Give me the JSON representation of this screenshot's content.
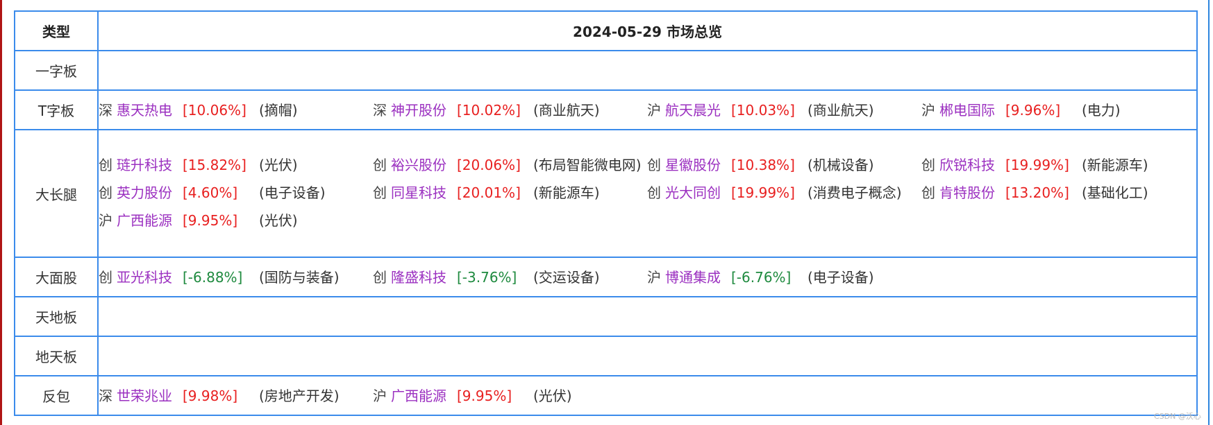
{
  "header": {
    "type_col": "类型",
    "title": "2024-05-29 市场总览"
  },
  "rows": [
    {
      "label": "一字板",
      "items": []
    },
    {
      "label": "T字板",
      "items": [
        {
          "market": "深",
          "name": "惠天热电",
          "pct": "[10.06%]",
          "sector": "(摘帽)",
          "dir": "up"
        },
        {
          "market": "深",
          "name": "神开股份",
          "pct": "[10.02%]",
          "sector": "(商业航天)",
          "dir": "up"
        },
        {
          "market": "沪",
          "name": "航天晨光",
          "pct": "[10.03%]",
          "sector": "(商业航天)",
          "dir": "up"
        },
        {
          "market": "沪",
          "name": "郴电国际",
          "pct": "[9.96%]",
          "sector": "(电力)",
          "dir": "up"
        }
      ]
    },
    {
      "label": "大长腿",
      "items": [
        {
          "market": "创",
          "name": "琏升科技",
          "pct": "[15.82%]",
          "sector": "(光伏)",
          "dir": "up"
        },
        {
          "market": "创",
          "name": "裕兴股份",
          "pct": "[20.06%]",
          "sector": "(布局智能微电网)",
          "dir": "up"
        },
        {
          "market": "创",
          "name": "星徽股份",
          "pct": "[10.38%]",
          "sector": "(机械设备)",
          "dir": "up"
        },
        {
          "market": "创",
          "name": "欣锐科技",
          "pct": "[19.99%]",
          "sector": "(新能源车)",
          "dir": "up"
        },
        {
          "market": "创",
          "name": "英力股份",
          "pct": "[4.60%]",
          "sector": "(电子设备)",
          "dir": "up"
        },
        {
          "market": "创",
          "name": "同星科技",
          "pct": "[20.01%]",
          "sector": "(新能源车)",
          "dir": "up"
        },
        {
          "market": "创",
          "name": "光大同创",
          "pct": "[19.99%]",
          "sector": "(消费电子概念)",
          "dir": "up"
        },
        {
          "market": "创",
          "name": "肯特股份",
          "pct": "[13.20%]",
          "sector": "(基础化工)",
          "dir": "up"
        },
        {
          "market": "沪",
          "name": "广西能源",
          "pct": "[9.95%]",
          "sector": "(光伏)",
          "dir": "up"
        }
      ]
    },
    {
      "label": "大面股",
      "items": [
        {
          "market": "创",
          "name": "亚光科技",
          "pct": "[-6.88%]",
          "sector": "(国防与装备)",
          "dir": "down"
        },
        {
          "market": "创",
          "name": "隆盛科技",
          "pct": "[-3.76%]",
          "sector": "(交运设备)",
          "dir": "down"
        },
        {
          "market": "沪",
          "name": "博通集成",
          "pct": "[-6.76%]",
          "sector": "(电子设备)",
          "dir": "down"
        }
      ]
    },
    {
      "label": "天地板",
      "items": []
    },
    {
      "label": "地天板",
      "items": []
    },
    {
      "label": "反包",
      "items": [
        {
          "market": "深",
          "name": "世荣兆业",
          "pct": "[9.98%]",
          "sector": "(房地产开发)",
          "dir": "up"
        },
        {
          "market": "沪",
          "name": "广西能源",
          "pct": "[9.95%]",
          "sector": "(光伏)",
          "dir": "up"
        }
      ]
    }
  ],
  "colors": {
    "up": "#e82020",
    "down": "#1e8a3e",
    "name": "#9b30c0",
    "border": "#3b8beb"
  },
  "watermark": "CSDN @沃心"
}
